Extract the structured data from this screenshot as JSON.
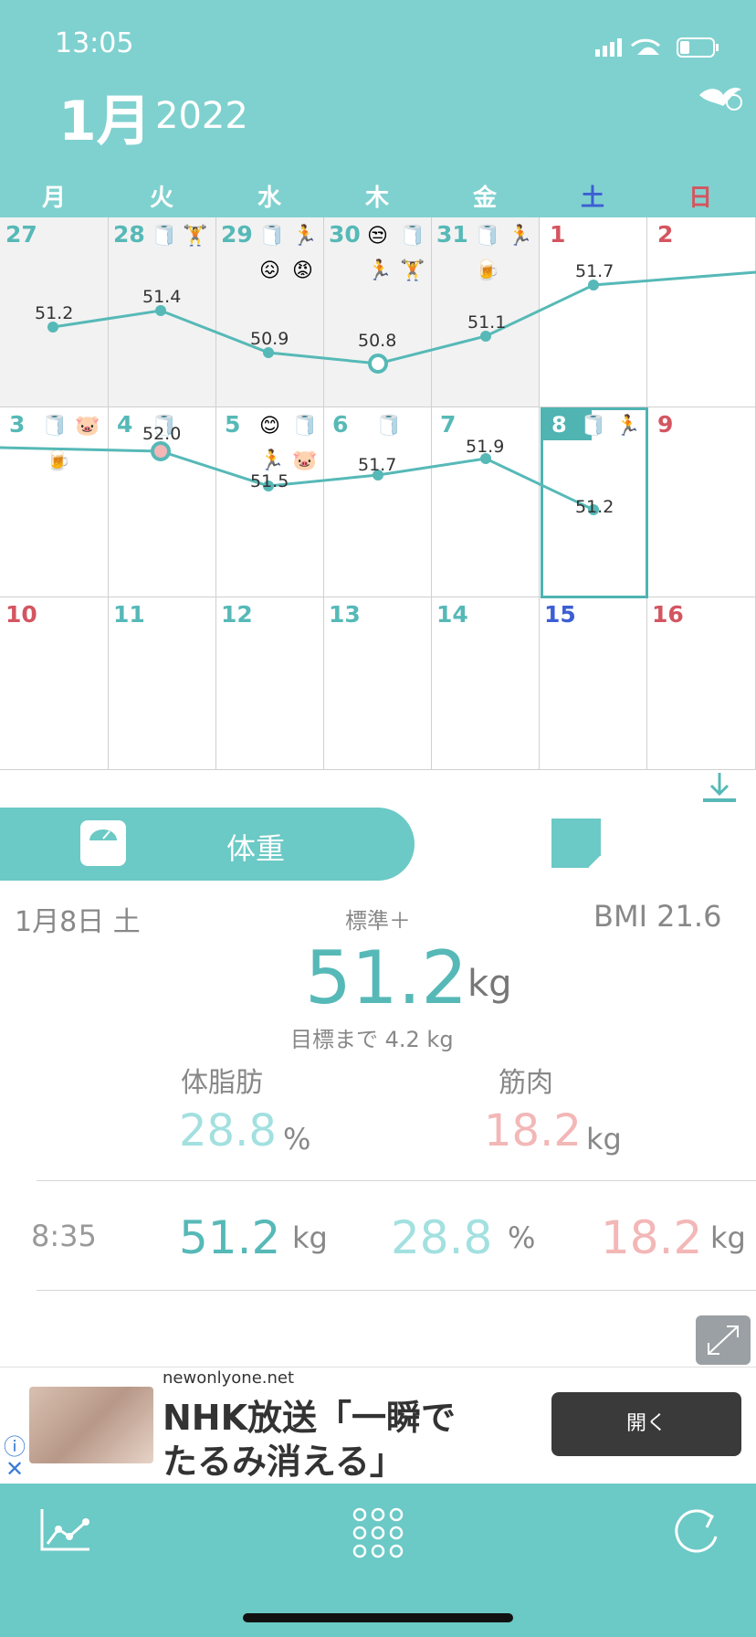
{
  "status_bar": {
    "time": "13:05"
  },
  "header": {
    "month": "1月",
    "year": "2022"
  },
  "weekdays": [
    "月",
    "火",
    "水",
    "木",
    "金",
    "土",
    "日"
  ],
  "calendar": {
    "week1": [
      "27",
      "28",
      "29",
      "30",
      "31",
      "1",
      "2"
    ],
    "week2": [
      "3",
      "4",
      "5",
      "6",
      "7",
      "8",
      "9"
    ],
    "week3": [
      "10",
      "11",
      "12",
      "13",
      "14",
      "15",
      "16"
    ],
    "weights": [
      "51.2",
      "51.4",
      "50.9",
      "50.8",
      "51.1",
      "51.7",
      "52.0",
      "51.5",
      "51.7",
      "51.9",
      "51.2"
    ]
  },
  "panel": {
    "tab_weight": "体重",
    "date": "1月8日 土",
    "standard": "標準＋",
    "bmi": "BMI 21.6",
    "weight": "51.2",
    "weight_unit": "kg",
    "goal": "目標まで 4.2 kg",
    "fat_label": "体脂肪",
    "fat_value": "28.8",
    "fat_unit": "%",
    "muscle_label": "筋肉",
    "muscle_value": "18.2",
    "muscle_unit": "kg"
  },
  "record": {
    "time": "8:35",
    "weight": "51.2",
    "weight_unit": "kg",
    "fat": "28.8",
    "fat_unit": "%",
    "muscle": "18.2",
    "muscle_unit": "kg"
  },
  "ad": {
    "domain": "newonlyone.net",
    "title": "NHK放送「一瞬でたるみ消える」",
    "button": "開く",
    "info": "ⓘ",
    "close": "✕"
  },
  "icons": {
    "toilet": "🧻",
    "dumbbell": "🏋",
    "running": "🏃",
    "unamused": "😒",
    "confounded": "😖",
    "angry": "😡",
    "beer": "🍺",
    "pig": "🐷",
    "smile": "😊"
  }
}
